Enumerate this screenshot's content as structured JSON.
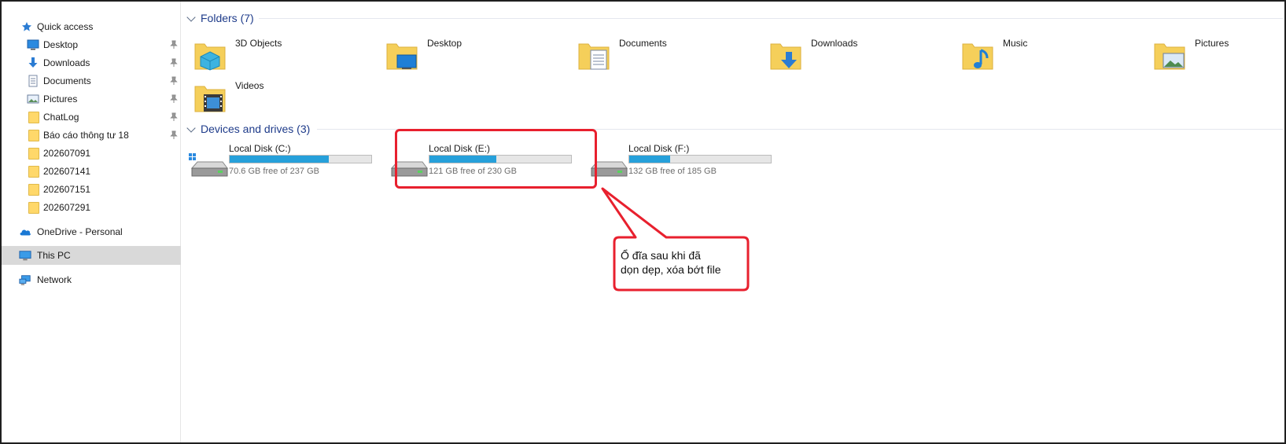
{
  "sidebar": {
    "quick_access": "Quick access",
    "pinned": [
      {
        "label": "Desktop",
        "icon": "desktop-icon"
      },
      {
        "label": "Downloads",
        "icon": "downloads-icon"
      },
      {
        "label": "Documents",
        "icon": "documents-icon"
      },
      {
        "label": "Pictures",
        "icon": "pictures-icon"
      },
      {
        "label": "ChatLog",
        "icon": "folder-icon"
      },
      {
        "label": "Báo cáo thông tư 18",
        "icon": "folder-icon"
      }
    ],
    "recent": [
      {
        "label": "202607091",
        "icon": "folder-icon"
      },
      {
        "label": "202607141",
        "icon": "folder-icon"
      },
      {
        "label": "202607151",
        "icon": "folder-icon"
      },
      {
        "label": "202607291",
        "icon": "folder-icon"
      }
    ],
    "onedrive": "OneDrive - Personal",
    "this_pc": "This PC",
    "network": "Network"
  },
  "folders": {
    "header": "Folders (7)",
    "items": [
      {
        "label": "3D Objects",
        "icon": "3d-objects-icon"
      },
      {
        "label": "Desktop",
        "icon": "desktop-folder-icon"
      },
      {
        "label": "Documents",
        "icon": "documents-folder-icon"
      },
      {
        "label": "Downloads",
        "icon": "downloads-folder-icon"
      },
      {
        "label": "Music",
        "icon": "music-folder-icon"
      },
      {
        "label": "Pictures",
        "icon": "pictures-folder-icon"
      },
      {
        "label": "Videos",
        "icon": "videos-folder-icon"
      }
    ]
  },
  "drives": {
    "header": "Devices and drives (3)",
    "items": [
      {
        "label": "Local Disk (C:)",
        "free": "70.6 GB free of 237 GB",
        "used_fraction": 0.7
      },
      {
        "label": "Local Disk (E:)",
        "free": "121 GB free of 230 GB",
        "used_fraction": 0.47
      },
      {
        "label": "Local Disk (F:)",
        "free": "132 GB free of 185 GB",
        "used_fraction": 0.29
      }
    ]
  },
  "callout": {
    "text": "Ổ đĩa sau khi đã\ndọn dẹp, xóa bớt file"
  },
  "colors": {
    "accent": "#26a0da",
    "annotation": "#e8202e",
    "group_title": "#1e3b8a"
  }
}
